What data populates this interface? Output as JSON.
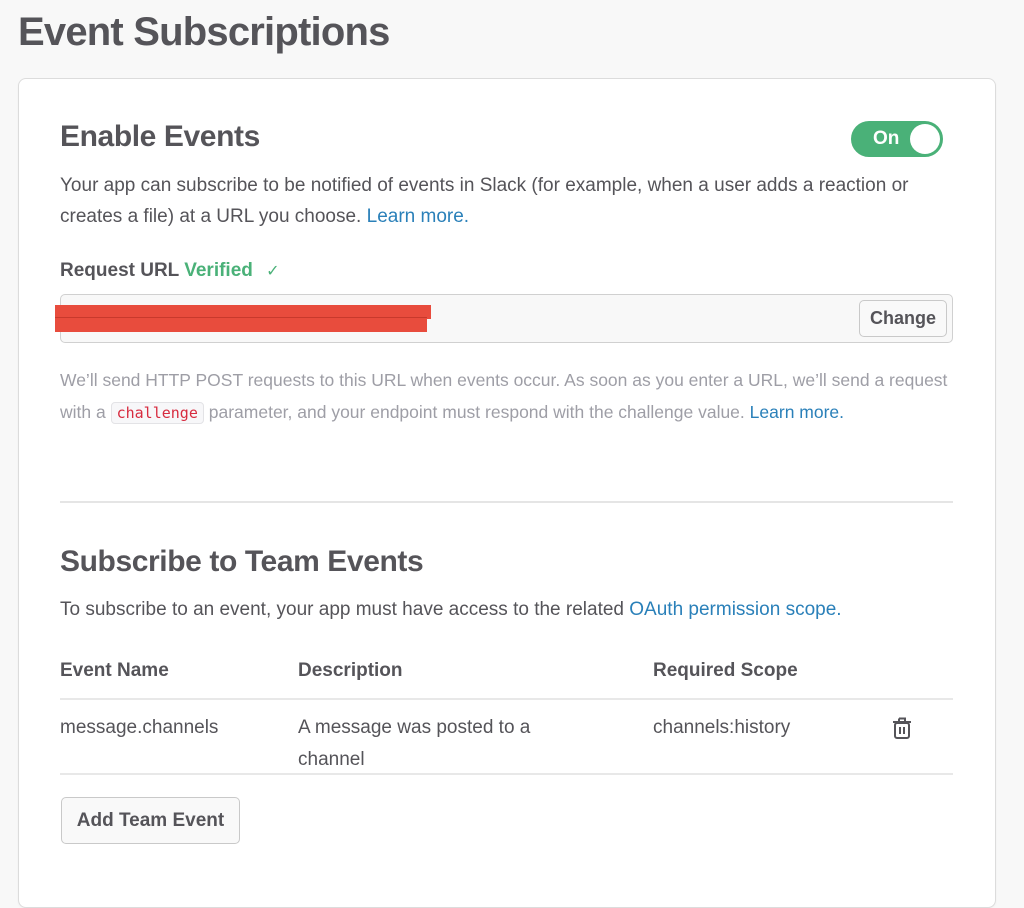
{
  "page": {
    "title": "Event Subscriptions"
  },
  "enable_events": {
    "title": "Enable Events",
    "toggle": {
      "label": "On",
      "state": "on",
      "color": "#4ab178"
    },
    "description": "Your app can subscribe to be notified of events in Slack (for example, when a user adds a reaction or creates a file) at a URL you choose.",
    "learn_more": "Learn more.",
    "request_url": {
      "label": "Request URL",
      "status": "Verified",
      "status_icon": "checkmark-icon",
      "value": "[redacted]",
      "change_button": "Change"
    },
    "help": {
      "part1": "We’ll send HTTP POST requests to this URL when events occur. As soon as you enter a URL, we’ll send a request with a",
      "code": "challenge",
      "part2": "parameter, and your endpoint must respond with the challenge value.",
      "learn_more": "Learn more."
    }
  },
  "team_events": {
    "title": "Subscribe to Team Events",
    "description": "To subscribe to an event, your app must have access to the related",
    "scope_link": "OAuth permission scope.",
    "table": {
      "headers": [
        "Event Name",
        "Description",
        "Required Scope"
      ],
      "rows": [
        {
          "event_name": "message.channels",
          "description": "A message was posted to a channel",
          "required_scope": "channels:history",
          "action_icon": "trash-icon"
        }
      ]
    },
    "add_button": "Add Team Event"
  },
  "colors": {
    "accent_green": "#4ab178",
    "link_blue": "#2a80b9",
    "code_red": "#d72b3f",
    "redaction_red": "#e84c3d"
  }
}
